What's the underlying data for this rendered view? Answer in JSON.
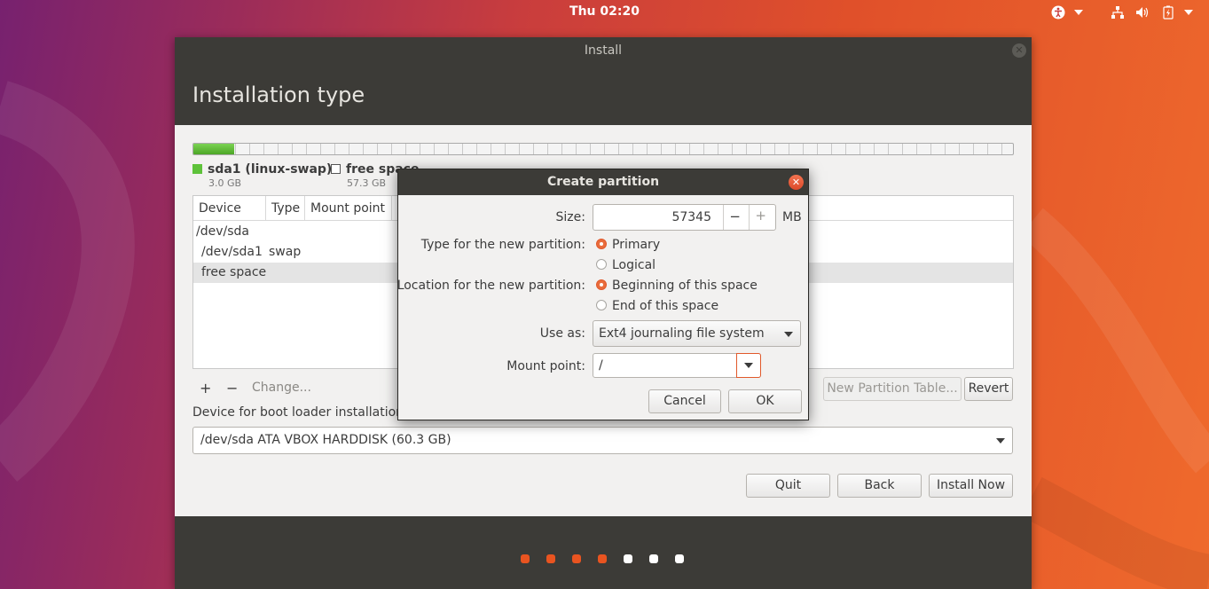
{
  "topbar": {
    "clock": "Thu 02:20",
    "icons": [
      "accessibility-icon",
      "network-icon",
      "volume-icon",
      "battery-icon"
    ]
  },
  "window": {
    "title": "Install",
    "header": "Installation type"
  },
  "partitions_bar": {
    "legend": [
      {
        "name": "sda1 (linux-swap)",
        "size": "3.0 GB",
        "color": "#5ec23a"
      },
      {
        "name": "free space",
        "size": "57.3 GB",
        "color": "#ffffff"
      }
    ],
    "swap_fraction": 0.05
  },
  "table": {
    "columns": [
      "Device",
      "Type",
      "Mount point"
    ],
    "rows": [
      {
        "device": "/dev/sda",
        "type": ""
      },
      {
        "device": "/dev/sda1",
        "type": "swap"
      },
      {
        "device": "free space",
        "type": ""
      }
    ]
  },
  "partition_buttons": {
    "add": "+",
    "remove": "−",
    "change": "Change...",
    "new_table": "New Partition Table...",
    "revert": "Revert"
  },
  "bootloader": {
    "label": "Device for boot loader installation",
    "value": "/dev/sda ATA VBOX HARDDISK (60.3 GB)"
  },
  "nav": {
    "quit": "Quit",
    "back": "Back",
    "install": "Install Now"
  },
  "progress_dots": {
    "total": 7,
    "done": 4,
    "done_color": "#e95420",
    "todo_color": "#ffffff"
  },
  "dialog": {
    "title": "Create partition",
    "size_label": "Size:",
    "size_value": "57345",
    "size_unit": "MB",
    "type_label": "Type for the new partition:",
    "type_options": [
      "Primary",
      "Logical"
    ],
    "type_selected": "Primary",
    "location_label": "Location for the new partition:",
    "location_options": [
      "Beginning of this space",
      "End of this space"
    ],
    "location_selected": "Beginning of this space",
    "use_as_label": "Use as:",
    "use_as_value": "Ext4 journaling file system",
    "mount_label": "Mount point:",
    "mount_value": "/",
    "cancel": "Cancel",
    "ok": "OK"
  },
  "colors": {
    "accent": "#e95420",
    "titlebar": "#3c3b37"
  }
}
